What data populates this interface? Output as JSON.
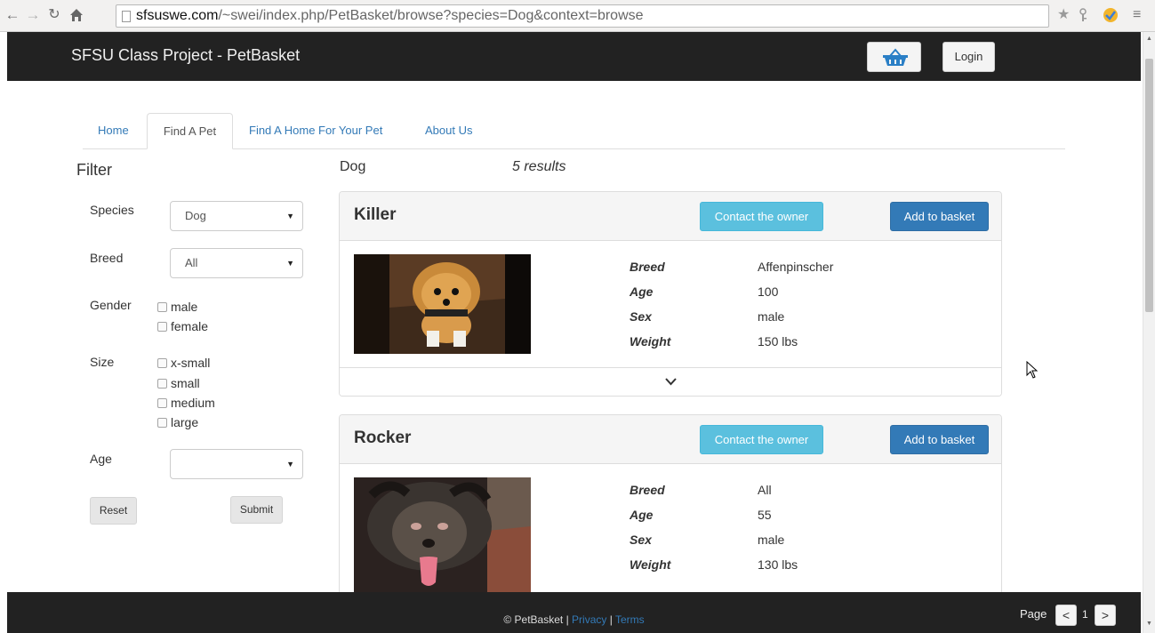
{
  "browser": {
    "url_host": "sfsuswe.com",
    "url_path": "/~swei/index.php/PetBasket/browse?species=Dog&context=browse",
    "back_icon": "back-arrow-icon",
    "forward_icon": "forward-arrow-icon",
    "reload_icon": "reload-icon",
    "home_icon": "home-icon"
  },
  "header": {
    "brand": "SFSU Class Project - PetBasket",
    "login_label": "Login",
    "basket_icon": "basket-icon",
    "colors": {
      "navbar": "#222222",
      "basket_icon": "#2a7fc6"
    }
  },
  "tabs": [
    {
      "label": "Home",
      "active": false
    },
    {
      "label": "Find A Pet",
      "active": true
    },
    {
      "label": "Find A Home For Your Pet",
      "active": false
    },
    {
      "label": "About Us",
      "active": false
    }
  ],
  "filter": {
    "title": "Filter",
    "species": {
      "label": "Species",
      "value": "Dog"
    },
    "breed": {
      "label": "Breed",
      "value": "All"
    },
    "gender": {
      "label": "Gender",
      "options": [
        "male",
        "female"
      ]
    },
    "size": {
      "label": "Size",
      "options": [
        "x-small",
        "small",
        "medium",
        "large"
      ]
    },
    "age": {
      "label": "Age",
      "value": ""
    },
    "reset_label": "Reset",
    "submit_label": "Submit"
  },
  "results": {
    "species": "Dog",
    "count": "5 results",
    "contact_label": "Contact the owner",
    "add_label": "Add to basket",
    "attr_labels": {
      "breed": "Breed",
      "age": "Age",
      "sex": "Sex",
      "weight": "Weight"
    },
    "pets": [
      {
        "name": "Killer",
        "breed": "Affenpinscher",
        "age": "100",
        "sex": "male",
        "weight": "150 lbs"
      },
      {
        "name": "Rocker",
        "breed": "All",
        "age": "55",
        "sex": "male",
        "weight": "130 lbs"
      }
    ],
    "colors": {
      "contact": "#5bc0de",
      "add": "#337ab7"
    }
  },
  "footer": {
    "copyright": "© PetBasket",
    "separator": " | ",
    "privacy": "Privacy",
    "terms": "Terms",
    "page_label": "Page",
    "page_number": "1"
  }
}
